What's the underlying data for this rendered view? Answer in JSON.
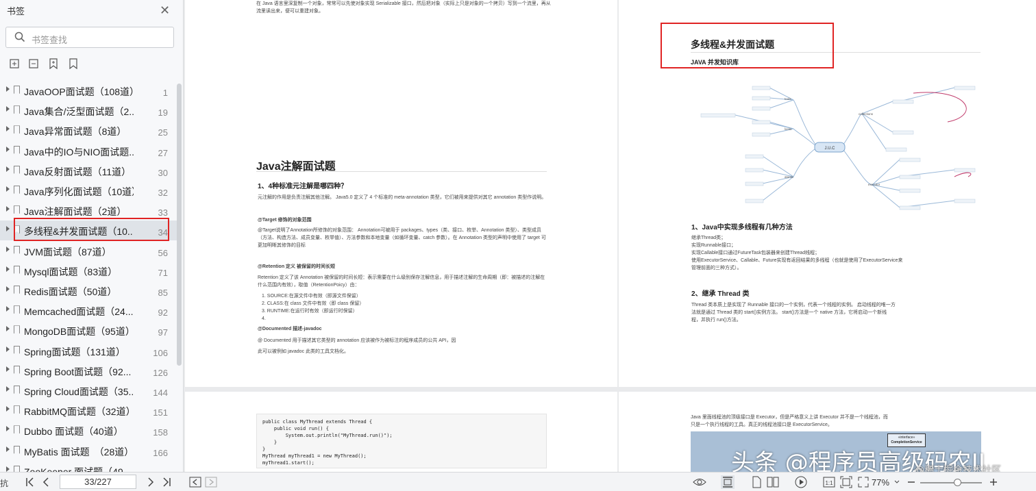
{
  "sidebar": {
    "title": "书签",
    "close_glyph": "✕",
    "search_placeholder": "书签查找",
    "tool_icons": [
      "add-bookmark-icon",
      "remove-bookmark-icon",
      "bookmark-add-icon",
      "bookmark-icon"
    ],
    "items": [
      {
        "label": "JavaOOP面试题（108道）",
        "page": "1"
      },
      {
        "label": "Java集合/泛型面试题（2...",
        "page": "19"
      },
      {
        "label": "Java异常面试题（8道）",
        "page": "25"
      },
      {
        "label": "Java中的IO与NIO面试题...",
        "page": "27"
      },
      {
        "label": "Java反射面试题（11道）",
        "page": "30"
      },
      {
        "label": "Java序列化面试题（10道）",
        "page": "32"
      },
      {
        "label": "Java注解面试题（2道）",
        "page": "33"
      },
      {
        "label": "多线程&并发面试题（10...",
        "page": "34"
      },
      {
        "label": "JVM面试题（87道）",
        "page": "56"
      },
      {
        "label": "Mysql面试题（83道）",
        "page": "71"
      },
      {
        "label": "Redis面试题（50道）",
        "page": "85"
      },
      {
        "label": "Memcached面试题（24...",
        "page": "92"
      },
      {
        "label": "MongoDB面试题（95道）",
        "page": "97"
      },
      {
        "label": "Spring面试题（131道）",
        "page": "106"
      },
      {
        "label": "Spring Boot面试题（92...",
        "page": "126"
      },
      {
        "label": "Spring Cloud面试题（35...",
        "page": "144"
      },
      {
        "label": "RabbitMQ面试题（32道）",
        "page": "151"
      },
      {
        "label": "Dubbo 面试题（40道）",
        "page": "158"
      },
      {
        "label": "MyBatis 面试题　（28道）",
        "page": "166"
      },
      {
        "label": "ZooKeeper 面试题（49...",
        "page": ""
      }
    ],
    "selected_index": 7
  },
  "page_left": {
    "top_text": "在 Java 语言里深复制一个对象，常常可以先使对象实现 Serializable 接口，然后把对象（实际上只是对象的一个拷贝）写到一个流里，再从流里读出来，便可以重建对象。",
    "title": "Java注解面试题",
    "q1": "1、4种标准元注解是哪四种？",
    "p1": "元注解的作用是负责注解其他注解。 Java5.0 定义了 4 个标准的 meta-annotation 类型，它们被用来提供对其它 annotation 类型作说明。",
    "target_title": "@Target 修饰的对象范围",
    "target_text": "@Target说明了Annotation所修饰的对象范围： Annotation可被用于 packages、types（类、接口、枚举、Annotation 类型）、类型成员（方法、构造方法、成员变量、枚举值）、方法参数和本地变量（如循环变量、catch 参数）。在 Annotation 类型的声明中使用了 target 可更加明晰其修饰的目标",
    "retention_title": "@Retention 定义 被保留的时间长短",
    "retention_text": "Retention 定义了该 Annotation 被保留的时间长短：表示需要在什么级别保存注解信息，用于描述注解的生命周期（即：被描述的注解在什么范围内有效），取值（RetentionPoicy）由：",
    "retention_list": [
      "SOURCE:在源文件中有效（即源文件保留）",
      "CLASS:在 class 文件中有效（即 class 保留）",
      "RUNTIME:在运行时有效（即运行时保留）",
      ""
    ],
    "documented_title": "@Documented 描述-javadoc",
    "documented_text": "@ Documented 用于描述其它类型的 annotation 应该被作为被标注的程序成员的公共 API，因",
    "documented_text2": "此可以被例如 javadoc 此类的工具文档化。"
  },
  "page_right": {
    "title": "多线程&并发面试题",
    "subtitle": "JAVA 并发知识库",
    "mindmap_center": "J.U.C",
    "mindmap_nodes": [
      "tools",
      "locks",
      "atomic",
      "collections",
      "executor"
    ],
    "q1": "1、Java中实现多线程有几种方法",
    "q1_lines": [
      "继承Thread类；",
      "实现Runnable接口；",
      "实现Callable接口通过FutureTask包装器来创建Thread线程；",
      "使用ExecutorService、Callable、Future实现有返回结果的多线程（也就是使用了ExecutorService来",
      "管理前面的三种方式）。"
    ],
    "q2": "2、继承 Thread 类",
    "q2_text1": "Thread 类本质上是实现了 Runnable 接口的一个实例，代表一个线程的实例。 启动线程的唯一方",
    "q2_text2": "法就是通过 Thread 类的 start()实例方法。 start()方法是一个 native 方法，它将启动一个新线",
    "q2_text3": "程，并执行 run()方法。"
  },
  "page_bottom_left": {
    "code_lines": [
      "public class MyThread extends Thread {",
      "    public void run() {",
      "        System.out.println(\"MyThread.run()\");",
      "    }",
      "}",
      "MyThread myThread1 = new MyThread();",
      "myThread1.start();"
    ]
  },
  "page_bottom_right": {
    "text1": "Java 里面线程池的顶级接口是 Executor，但是严格意义上讲 Executor 并不是一个线程池，而",
    "text2": "只是一个执行线程的工具。真正的线程池接口是 ExecutorService。",
    "diagram_label1": "«interface»",
    "diagram_label2": "CompletionService"
  },
  "bottombar": {
    "left_label": "抗",
    "page_indicator": "33/227",
    "zoom": "77%",
    "zoom_level_percent": 77
  },
  "watermark": {
    "main": "头条 @程序员高级码农II",
    "sub": "@稀土掘金技术社区"
  },
  "colors": {
    "highlight_box": "#e02323",
    "selected_row": "#dfe3e8"
  }
}
